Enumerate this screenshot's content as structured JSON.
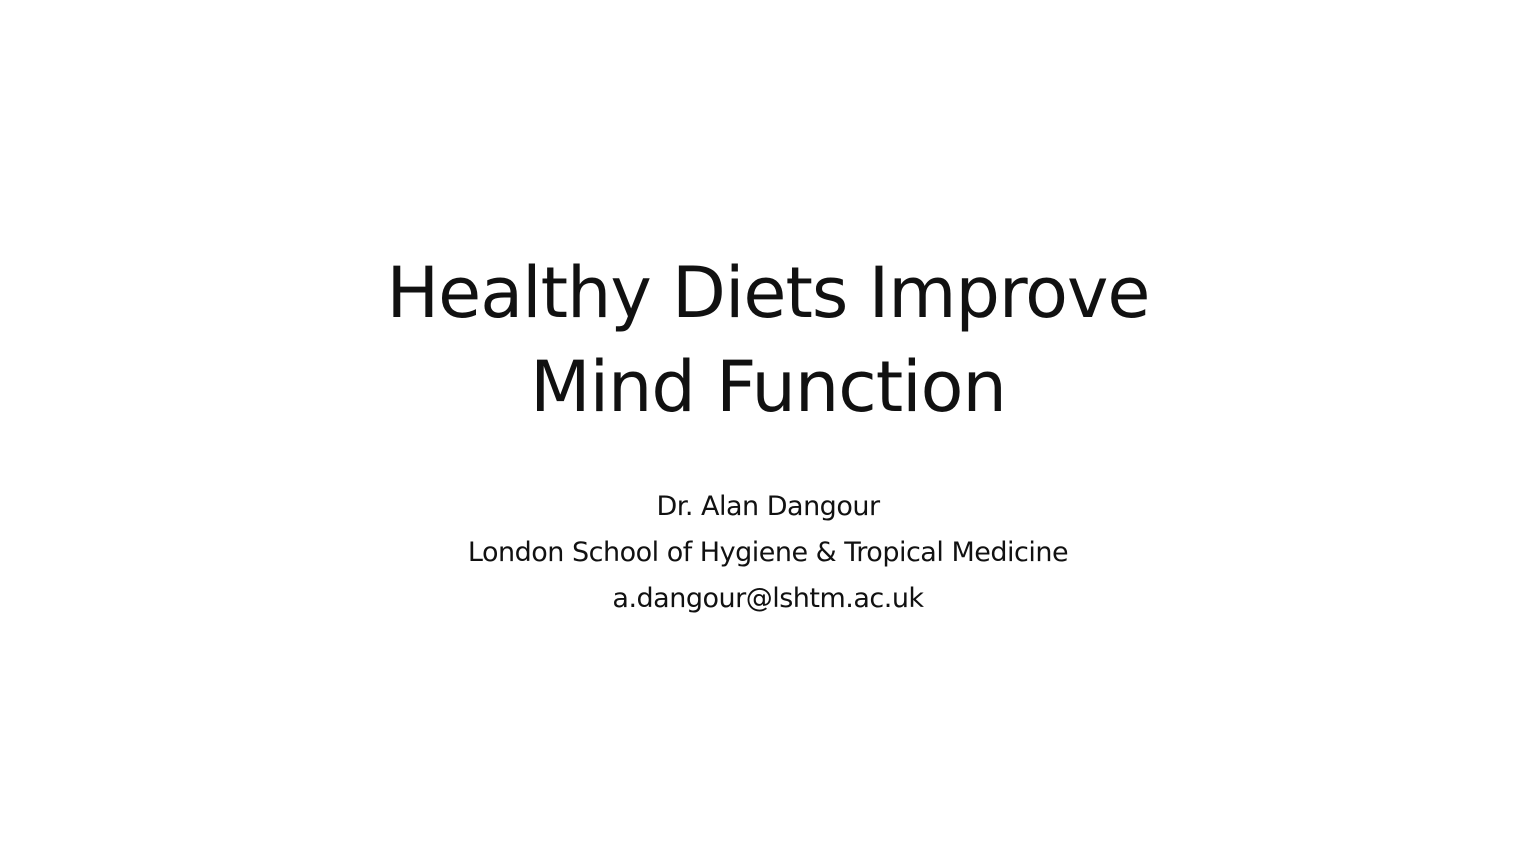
{
  "slide": {
    "title_lines": [
      "Healthy Diets Improve",
      "Mind Function"
    ],
    "subtitle_lines": [
      "Dr. Alan Dangour",
      "London School of Hygiene & Tropical Medicine",
      "a.dangour@lshtm.ac.uk"
    ],
    "background_color": "#ffffff",
    "text_color": "#000000"
  }
}
